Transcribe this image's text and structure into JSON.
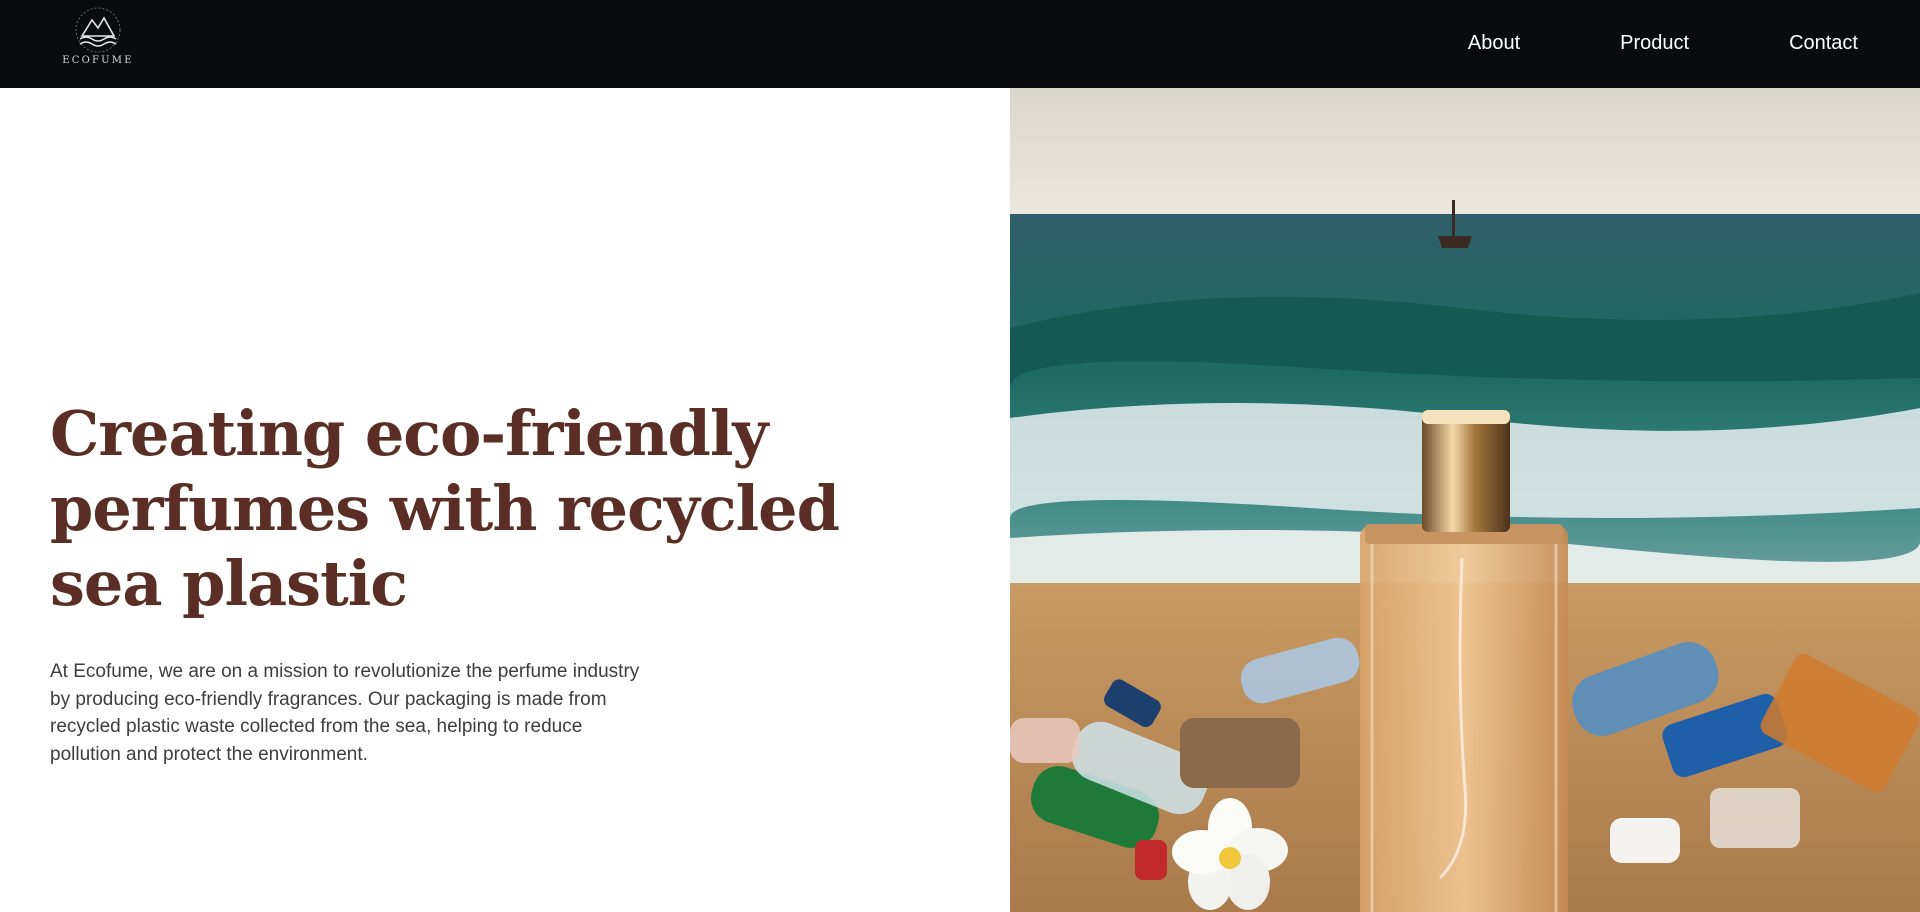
{
  "brand": {
    "name": "ECOFUME",
    "logo_icon": "mountain-wave-logo-icon"
  },
  "nav": {
    "items": [
      {
        "label": "About"
      },
      {
        "label": "Product"
      },
      {
        "label": "Contact"
      }
    ]
  },
  "hero": {
    "title": "Creating eco-friendly perfumes with recycled sea plastic",
    "description": "At Ecofume, we are on a mission to revolutionize the perfume industry by producing eco-friendly fragrances. Our packaging is made from recycled plastic waste collected from the sea, helping to reduce pollution and protect the environment.",
    "image_subject": "perfume-bottle-on-beach-with-plastic-waste"
  },
  "colors": {
    "header_bg": "#0a0b0f",
    "title": "#5a2e24",
    "body_text": "#3d3d3d"
  }
}
